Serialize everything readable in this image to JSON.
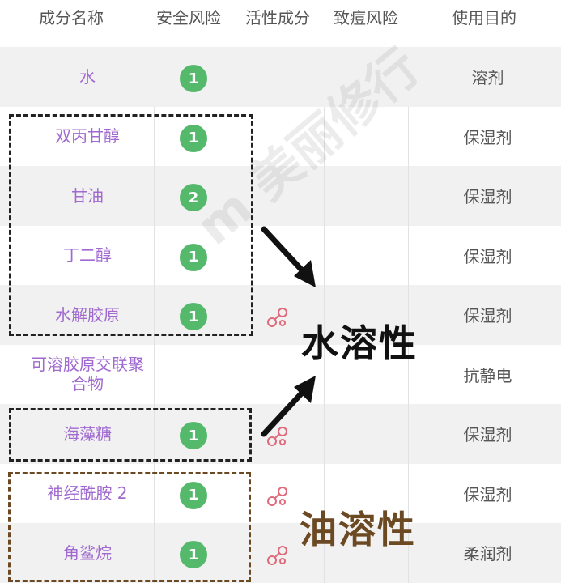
{
  "header": {
    "columns": [
      "成分名称",
      "安全风险",
      "活性成分",
      "致痘风险",
      "使用目的"
    ]
  },
  "rows": [
    {
      "name": "水",
      "safety": "1",
      "active": false,
      "purpose": "溶剂"
    },
    {
      "name": "双丙甘醇",
      "safety": "1",
      "active": false,
      "purpose": "保湿剂"
    },
    {
      "name": "甘油",
      "safety": "2",
      "active": false,
      "purpose": "保湿剂"
    },
    {
      "name": "丁二醇",
      "safety": "1",
      "active": false,
      "purpose": "保湿剂"
    },
    {
      "name": "水解胶原",
      "safety": "1",
      "active": true,
      "purpose": "保湿剂"
    },
    {
      "name": "可溶胶原交联聚\n合物",
      "safety": "",
      "active": false,
      "purpose": "抗静电"
    },
    {
      "name": "海藻糖",
      "safety": "1",
      "active": true,
      "purpose": "保湿剂"
    },
    {
      "name": "神经酰胺 2",
      "safety": "1",
      "active": true,
      "purpose": "保湿剂"
    },
    {
      "name": "角鲨烷",
      "safety": "1",
      "active": true,
      "purpose": "柔润剂"
    }
  ],
  "annotations": {
    "water_soluble": "水溶性",
    "oil_soluble": "油溶性"
  },
  "colors": {
    "ingredient_name": "#a06ad0",
    "safety_badge": "#55b96b",
    "water_label": "#111111",
    "oil_label": "#6b4a23"
  }
}
